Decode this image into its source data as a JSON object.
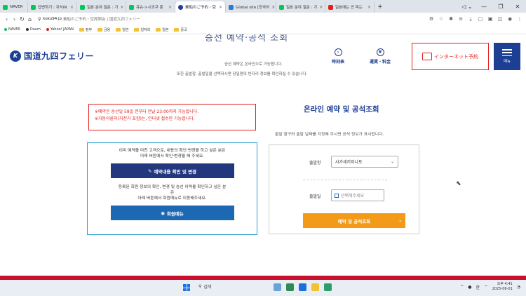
{
  "browser": {
    "tabs": [
      {
        "label": "NAVER",
        "color": "#03c75a",
        "active": false
      },
      {
        "label": "답변하기 : 지식iN",
        "color": "#03c75a",
        "active": false
      },
      {
        "label": "일본 분야 질문 : 기",
        "color": "#03c75a",
        "active": false
      },
      {
        "label": "큐슈->시코쿠 훈",
        "color": "#03c75a",
        "active": false
      },
      {
        "label": "乗船のご予約・受",
        "color": "#1c3f94",
        "active": true
      },
      {
        "label": "Global site [한국어",
        "color": "#2a7bd5",
        "active": false
      },
      {
        "label": "일본 분야 질문 : 기",
        "color": "#03c75a",
        "active": false
      },
      {
        "label": "일본에는 안 파는",
        "color": "#e02020",
        "active": false
      }
    ],
    "url_domain": "koku94.jp",
    "url_title": "乗船のご予約・空席照会 | 国道九四フェリー",
    "bookmarks": [
      {
        "label": "NAVER",
        "type": "dot",
        "color": "#03c75a"
      },
      {
        "label": "Daum",
        "type": "dot",
        "color": "#333333"
      },
      {
        "label": "Yahoo! JAPAN",
        "type": "dot",
        "color": "#e02020"
      },
      {
        "label": "정부",
        "type": "folder"
      },
      {
        "label": "금융",
        "type": "folder"
      },
      {
        "label": "일반",
        "type": "folder"
      },
      {
        "label": "일자리",
        "type": "folder"
      },
      {
        "label": "일본",
        "type": "folder"
      },
      {
        "label": "중국",
        "type": "folder"
      }
    ]
  },
  "site": {
    "hero_title": "승선 예약·공석 조회",
    "logo_mark": "K",
    "logo_text": "国道九四フェリー",
    "hero_sub1": "승선 예약은 온라인으로 가능합니다.",
    "hero_sub2": "또한 출발항, 출발일을 선택하시면 당일편의 빈자리 정보를 확인하실 수 있습니다.",
    "nav": {
      "timetable": "時刻表",
      "fare": "運賃・料金",
      "internet_booking": "インターネット予約",
      "menu": "메뉴"
    }
  },
  "notice": {
    "line1": "※예약은 승선일 59일 전부터 전날 23:00까지 가능합니다.",
    "line2": "※자동이륜차(자전거 포함)는, 인터넷 접수만 가능합니다."
  },
  "member": {
    "text1a": "이미 예약을 마친 고객으로, 내용의 확인·변경을 하고 싶은 분은",
    "text1b": "아래 버튼에서 확인·변경을 해 주세요.",
    "confirm_button": "예약내용 확인 및 변경",
    "text2a": "등록된 회원 정보의 확인, 변경 및 승선 이력을 확인하고 싶은 분",
    "text2b": "은",
    "text2c": "아래 버튼에서 회원메뉴로 이동해주세요.",
    "member_button": "회원메뉴"
  },
  "booking": {
    "title": "온라인 예약 및 공석조회",
    "subtitle": "출발 항구와 출발 날짜를 지정해 주시면 공석 정보가 표시됩니다.",
    "port_label": "출발항",
    "port_value": "사가세키미나토",
    "date_label": "출발일",
    "date_placeholder": "선택해주세요",
    "search_button": "예약 및 공석조회"
  },
  "taskbar": {
    "search": "검색",
    "ime": "한",
    "time": "오후 4:41",
    "date": "2025-06-01"
  }
}
